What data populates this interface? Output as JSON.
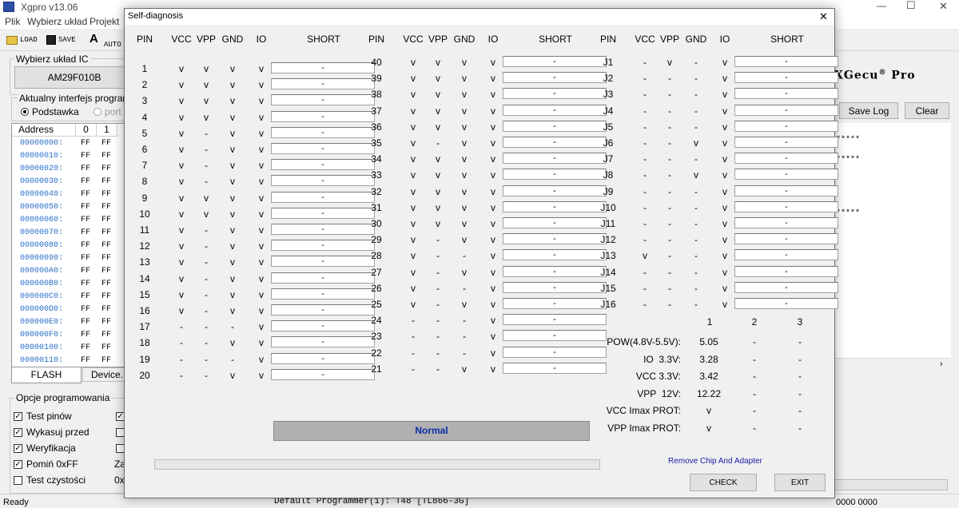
{
  "app": {
    "title": "Xgpro v13.06",
    "window_controls": [
      "—",
      "☐",
      "✕"
    ]
  },
  "menu": [
    "Plik",
    "Wybierz układ",
    "Projekt"
  ],
  "toolbar": {
    "load": "LOAD",
    "save": "SAVE",
    "auto": "AUTO"
  },
  "left": {
    "chip_group": "Wybierz układ IC",
    "chip": "AM29F010B",
    "iface_group": "Aktualny interfejs programa",
    "iface_opt1": "Podstawka",
    "iface_opt2": "port",
    "hex_headers": [
      "Address",
      "0",
      "1"
    ],
    "hex_rows": [
      [
        "00000000:",
        "FF",
        "FF"
      ],
      [
        "00000010:",
        "FF",
        "FF"
      ],
      [
        "00000020:",
        "FF",
        "FF"
      ],
      [
        "00000030:",
        "FF",
        "FF"
      ],
      [
        "00000040:",
        "FF",
        "FF"
      ],
      [
        "00000050:",
        "FF",
        "FF"
      ],
      [
        "00000060:",
        "FF",
        "FF"
      ],
      [
        "00000070:",
        "FF",
        "FF"
      ],
      [
        "00000080:",
        "FF",
        "FF"
      ],
      [
        "00000090:",
        "FF",
        "FF"
      ],
      [
        "000000A0:",
        "FF",
        "FF"
      ],
      [
        "000000B0:",
        "FF",
        "FF"
      ],
      [
        "000000C0:",
        "FF",
        "FF"
      ],
      [
        "000000D0:",
        "FF",
        "FF"
      ],
      [
        "000000E0:",
        "FF",
        "FF"
      ],
      [
        "000000F0:",
        "FF",
        "FF"
      ],
      [
        "00000100:",
        "FF",
        "FF"
      ],
      [
        "00000110:",
        "FF",
        "FF"
      ]
    ],
    "tabs": [
      "FLASH",
      "Device.In"
    ],
    "opts_group": "Opcje programowania",
    "opts": [
      {
        "label": "Test pinów",
        "checked": true
      },
      {
        "label": "Wykasuj przed",
        "checked": true
      },
      {
        "label": "Weryfikacja",
        "checked": true
      },
      {
        "label": "Pomiń 0xFF",
        "checked": true
      },
      {
        "label": "Test czystości",
        "checked": false
      }
    ],
    "opts_col2": [
      {
        "label": "",
        "checked": true
      },
      {
        "label": "",
        "checked": false
      },
      {
        "label": "",
        "checked": false
      },
      {
        "label": "Za",
        "checked": false
      },
      {
        "label": "0x",
        "checked": false
      }
    ]
  },
  "right": {
    "brand": "XGecu",
    "brand_sup": "®",
    "brand_tail": " Pro",
    "save_log": "Save Log",
    "clear": "Clear",
    "log_lines": [
      "*****",
      "*****",
      "*****"
    ]
  },
  "status": {
    "left": "Ready",
    "center": "Default Programmer(1): T48 [TL866-3G]",
    "right": "0000 0000"
  },
  "dialog": {
    "title": "Self-diagnosis",
    "close": "✕",
    "col_headers": [
      "PIN",
      "VCC",
      "VPP",
      "GND",
      "IO",
      "SHORT"
    ],
    "short_value": "-",
    "tableA": [
      [
        "1",
        "v",
        "v",
        "v",
        "v"
      ],
      [
        "2",
        "v",
        "v",
        "v",
        "v"
      ],
      [
        "3",
        "v",
        "v",
        "v",
        "v"
      ],
      [
        "4",
        "v",
        "v",
        "v",
        "v"
      ],
      [
        "5",
        "v",
        "-",
        "v",
        "v"
      ],
      [
        "6",
        "v",
        "-",
        "v",
        "v"
      ],
      [
        "7",
        "v",
        "-",
        "v",
        "v"
      ],
      [
        "8",
        "v",
        "-",
        "v",
        "v"
      ],
      [
        "9",
        "v",
        "v",
        "v",
        "v"
      ],
      [
        "10",
        "v",
        "v",
        "v",
        "v"
      ],
      [
        "11",
        "v",
        "-",
        "v",
        "v"
      ],
      [
        "12",
        "v",
        "-",
        "v",
        "v"
      ],
      [
        "13",
        "v",
        "-",
        "v",
        "v"
      ],
      [
        "14",
        "v",
        "-",
        "v",
        "v"
      ],
      [
        "15",
        "v",
        "-",
        "v",
        "v"
      ],
      [
        "16",
        "v",
        "-",
        "v",
        "v"
      ],
      [
        "17",
        "-",
        "-",
        "-",
        "v"
      ],
      [
        "18",
        "-",
        "-",
        "v",
        "v"
      ],
      [
        "19",
        "-",
        "-",
        "-",
        "v"
      ],
      [
        "20",
        "-",
        "-",
        "v",
        "v"
      ]
    ],
    "tableB": [
      [
        "40",
        "v",
        "v",
        "v",
        "v"
      ],
      [
        "39",
        "v",
        "v",
        "v",
        "v"
      ],
      [
        "38",
        "v",
        "v",
        "v",
        "v"
      ],
      [
        "37",
        "v",
        "v",
        "v",
        "v"
      ],
      [
        "36",
        "v",
        "v",
        "v",
        "v"
      ],
      [
        "35",
        "v",
        "-",
        "v",
        "v"
      ],
      [
        "34",
        "v",
        "v",
        "v",
        "v"
      ],
      [
        "33",
        "v",
        "v",
        "v",
        "v"
      ],
      [
        "32",
        "v",
        "v",
        "v",
        "v"
      ],
      [
        "31",
        "v",
        "v",
        "v",
        "v"
      ],
      [
        "30",
        "v",
        "v",
        "v",
        "v"
      ],
      [
        "29",
        "v",
        "-",
        "v",
        "v"
      ],
      [
        "28",
        "v",
        "-",
        "-",
        "v"
      ],
      [
        "27",
        "v",
        "-",
        "v",
        "v"
      ],
      [
        "26",
        "v",
        "-",
        "-",
        "v"
      ],
      [
        "25",
        "v",
        "-",
        "v",
        "v"
      ],
      [
        "24",
        "-",
        "-",
        "-",
        "v"
      ],
      [
        "23",
        "-",
        "-",
        "-",
        "v"
      ],
      [
        "22",
        "-",
        "-",
        "-",
        "v"
      ],
      [
        "21",
        "-",
        "-",
        "v",
        "v"
      ]
    ],
    "tableJ": [
      [
        "J1",
        "-",
        "v",
        "-",
        "v"
      ],
      [
        "J2",
        "-",
        "-",
        "-",
        "v"
      ],
      [
        "J3",
        "-",
        "-",
        "-",
        "v"
      ],
      [
        "J4",
        "-",
        "-",
        "-",
        "v"
      ],
      [
        "J5",
        "-",
        "-",
        "-",
        "v"
      ],
      [
        "J6",
        "-",
        "-",
        "v",
        "v"
      ],
      [
        "J7",
        "-",
        "-",
        "-",
        "v"
      ],
      [
        "J8",
        "-",
        "-",
        "v",
        "v"
      ],
      [
        "J9",
        "-",
        "-",
        "-",
        "v"
      ],
      [
        "J10",
        "-",
        "-",
        "-",
        "v"
      ],
      [
        "J11",
        "-",
        "-",
        "-",
        "v"
      ],
      [
        "J12",
        "-",
        "-",
        "-",
        "v"
      ],
      [
        "J13",
        "v",
        "-",
        "-",
        "v"
      ],
      [
        "J14",
        "-",
        "-",
        "-",
        "v"
      ],
      [
        "J15",
        "-",
        "-",
        "-",
        "v"
      ],
      [
        "J16",
        "-",
        "-",
        "-",
        "v"
      ]
    ],
    "meas_cols": [
      "1",
      "2",
      "3"
    ],
    "measurements": [
      [
        "POW(4.8V-5.5V):",
        "5.05",
        "-",
        "-"
      ],
      [
        "IO  3.3V:",
        "3.28",
        "-",
        "-"
      ],
      [
        "VCC 3.3V:",
        "3.42",
        "-",
        "-"
      ],
      [
        "VPP  12V:",
        "12.22",
        "-",
        "-"
      ],
      [
        "VCC Imax PROT:",
        "v",
        "-",
        "-"
      ],
      [
        "VPP Imax PROT:",
        "v",
        "-",
        "-"
      ]
    ],
    "result": "Normal",
    "hint": "Remove Chip And Adapter",
    "check": "CHECK",
    "exit": "EXIT",
    "colors": {
      "result_bg": "#b0b0b0",
      "result_text": "#0a2ea8",
      "hint_text": "#1a1aa6"
    }
  }
}
